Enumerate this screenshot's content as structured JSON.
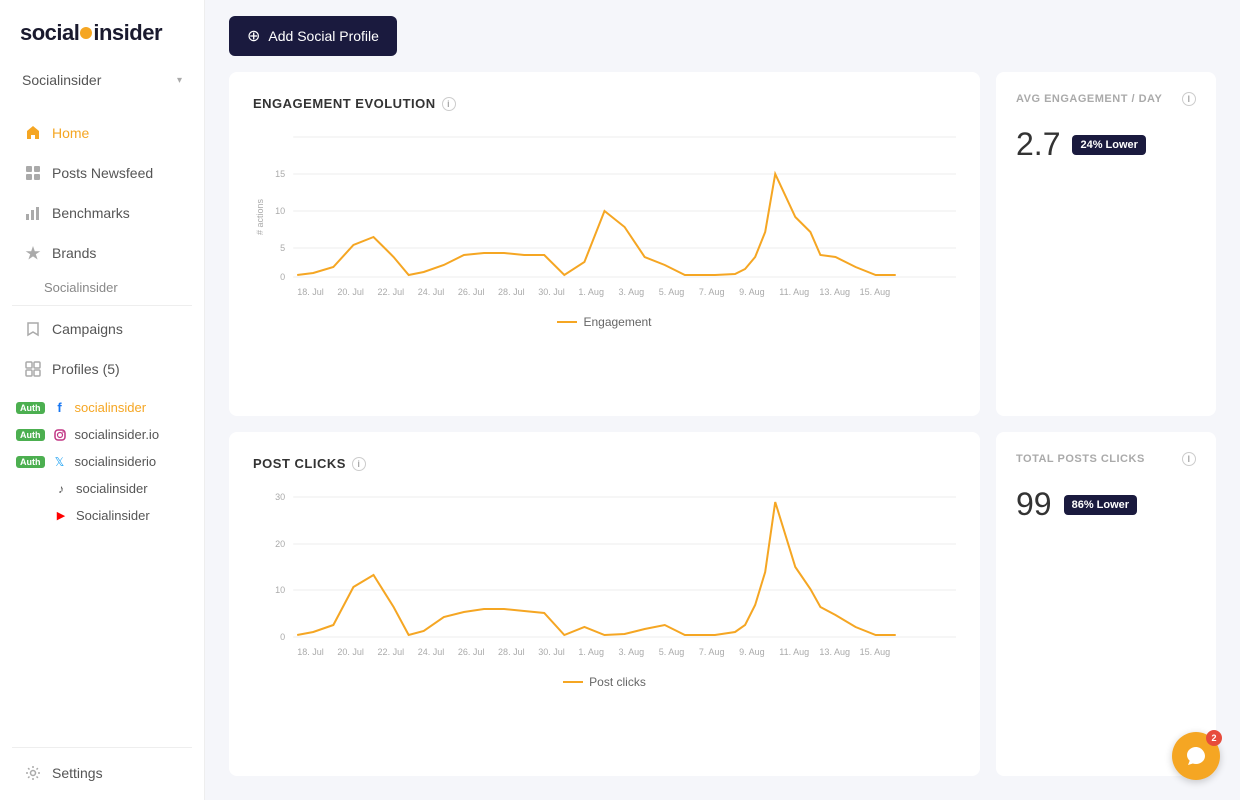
{
  "app": {
    "name": "socialinsider",
    "logo_parts": [
      "social",
      "insider"
    ]
  },
  "sidebar": {
    "project_label": "Socialinsider",
    "nav_items": [
      {
        "id": "home",
        "label": "Home",
        "active": true
      },
      {
        "id": "posts-newsfeed",
        "label": "Posts Newsfeed",
        "active": false
      },
      {
        "id": "benchmarks",
        "label": "Benchmarks",
        "active": false
      },
      {
        "id": "brands",
        "label": "Brands",
        "active": false
      }
    ],
    "brands_subitem": "Socialinsider",
    "campaigns_label": "Campaigns",
    "profiles_label": "Profiles (5)",
    "profiles": [
      {
        "id": "fb-socialinsider",
        "platform": "facebook",
        "name": "socialinsider",
        "auth": true
      },
      {
        "id": "ig-socialinsider",
        "platform": "instagram",
        "name": "socialinsider.io",
        "auth": true
      },
      {
        "id": "tw-socialinsider",
        "platform": "twitter",
        "name": "socialinsiderio",
        "auth": true
      },
      {
        "id": "tt-socialinsider",
        "platform": "tiktok",
        "name": "socialinsider",
        "auth": false
      },
      {
        "id": "yt-socialinsider",
        "platform": "youtube",
        "name": "Socialinsider",
        "auth": false
      }
    ],
    "settings_label": "Settings",
    "auth_label": "Auth"
  },
  "header": {
    "add_profile_label": "Add Social Profile"
  },
  "engagement_chart": {
    "title": "ENGAGEMENT EVOLUTION",
    "legend_label": "Engagement",
    "y_axis_label": "# actions",
    "y_ticks": [
      "0",
      "5",
      "10",
      "15"
    ],
    "x_ticks": [
      "18. Jul",
      "20. Jul",
      "22. Jul",
      "24. Jul",
      "26. Jul",
      "28. Jul",
      "30. Jul",
      "1. Aug",
      "3. Aug",
      "5. Aug",
      "7. Aug",
      "9. Aug",
      "11. Aug",
      "13. Aug",
      "15. Aug"
    ]
  },
  "post_clicks_chart": {
    "title": "POST CLICKS",
    "legend_label": "Post clicks",
    "y_ticks": [
      "0",
      "10",
      "20",
      "30"
    ],
    "x_ticks": [
      "18. Jul",
      "20. Jul",
      "22. Jul",
      "24. Jul",
      "26. Jul",
      "28. Jul",
      "30. Jul",
      "1. Aug",
      "3. Aug",
      "5. Aug",
      "7. Aug",
      "9. Aug",
      "11. Aug",
      "13. Aug",
      "15. Aug"
    ]
  },
  "stats": {
    "avg_engagement": {
      "title": "AVG ENGAGEMENT / DAY",
      "value": "2.7",
      "badge_label": "24% Lower",
      "badge_type": "dark"
    },
    "total_post_clicks": {
      "title": "TOTAL POSTS CLICKS",
      "value": "99",
      "badge_label": "86% Lower",
      "badge_type": "dark"
    }
  },
  "chat": {
    "badge_count": "2"
  }
}
